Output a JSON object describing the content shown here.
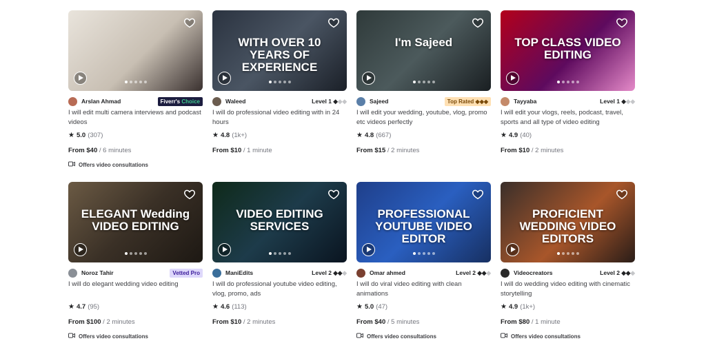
{
  "icons": {
    "favorite": "heart-icon",
    "play": "play-icon",
    "rating": "star-icon",
    "video": "video-camera-icon"
  },
  "gigs": [
    {
      "seller": "Arslan Ahmad",
      "badge": {
        "type": "choice",
        "text": "Fiverr's",
        "accent": "Choice"
      },
      "title": "I will edit multi camera interviews and podcast videos",
      "rating": "5.0",
      "reviews": "(307)",
      "price": "From $40",
      "delivery": "/ 6 minutes",
      "consultation": "Offers video consultations",
      "thumb_bg": "linear-gradient(135deg,#e9e4dc 0%,#c8bfb3 55%,#3b3230 100%)",
      "thumb_text": "",
      "avatar_color": "#b86b55"
    },
    {
      "seller": "Waleed",
      "level": {
        "text": "Level 1",
        "on": 1,
        "total": 3
      },
      "title": "I will do professional video editing with in 24 hours",
      "rating": "4.8",
      "reviews": "(1k+)",
      "price": "From $10",
      "delivery": "/ 1 minute",
      "thumb_bg": "linear-gradient(135deg,#2b3340 0%,#4a5563 50%,#1b2028 100%)",
      "thumb_text": "WITH OVER 10 YEARS OF EXPERIENCE",
      "avatar_color": "#6b5c4f"
    },
    {
      "seller": "Sajeed",
      "badge": {
        "type": "toprated",
        "text": "Top Rated ◆◆◆"
      },
      "title": "I will edit your wedding, youtube, vlog, promo etc videos perfectly",
      "rating": "4.8",
      "reviews": "(667)",
      "price": "From $15",
      "delivery": "/ 2 minutes",
      "thumb_bg": "linear-gradient(135deg,#2f3a3a 0%,#4c5a5c 50%,#1a1f22 100%)",
      "thumb_text": "I'm Sajeed",
      "avatar_color": "#5a7fa8"
    },
    {
      "seller": "Tayyaba",
      "level": {
        "text": "Level 1",
        "on": 1,
        "total": 3
      },
      "title": "I will edit your vlogs, reels, podcast, travel, sports and all type of video editing",
      "rating": "4.9",
      "reviews": "(40)",
      "price": "From $10",
      "delivery": "/ 2 minutes",
      "thumb_bg": "linear-gradient(135deg,#b3001b 0%,#5e0a5e 55%,#e48ac8 100%)",
      "thumb_text": "TOP CLASS VIDEO EDITING",
      "avatar_color": "#c48a6a"
    },
    {
      "seller": "Noroz Tahir",
      "badge": {
        "type": "vetted",
        "text": "Vetted Pro"
      },
      "title": "I will do elegant wedding video editing",
      "rating": "4.7",
      "reviews": "(95)",
      "price": "From $100",
      "delivery": "/ 2 minutes",
      "consultation": "Offers video consultations",
      "thumb_bg": "linear-gradient(135deg,#6b5a44 0%,#3a3026 50%,#1d1813 100%)",
      "thumb_text": "ELEGANT Wedding VIDEO EDITING",
      "avatar_color": "#8a8f96"
    },
    {
      "seller": "ManiEdits",
      "level": {
        "text": "Level 2",
        "on": 2,
        "total": 3
      },
      "title": "I will do professional youtube video editing, vlog, promo, ads",
      "rating": "4.6",
      "reviews": "(113)",
      "price": "From $10",
      "delivery": "/ 2 minutes",
      "thumb_bg": "linear-gradient(135deg,#0f2a1a 0%,#1d3b4a 50%,#0a1420 100%)",
      "thumb_text": "VIDEO EDITING SERVICES",
      "avatar_color": "#3a6e9a"
    },
    {
      "seller": "Omar ahmed",
      "level": {
        "text": "Level 2",
        "on": 2,
        "total": 3
      },
      "title": "I will do viral video editing with clean animations",
      "rating": "5.0",
      "reviews": "(47)",
      "price": "From $40",
      "delivery": "/ 5 minutes",
      "consultation": "Offers video consultations",
      "thumb_bg": "linear-gradient(135deg,#1f3f8a 0%,#2a5fc0 50%,#173062 100%)",
      "thumb_text": "PROFESSIONAL YOUTUBE VIDEO EDITOR",
      "avatar_color": "#7a4030"
    },
    {
      "seller": "Videocreators",
      "level": {
        "text": "Level 2",
        "on": 2,
        "total": 3
      },
      "title": "I will do wedding video editing with cinematic storytelling",
      "rating": "4.9",
      "reviews": "(1k+)",
      "price": "From $80",
      "delivery": "/ 1 minute",
      "consultation": "Offers video consultations",
      "thumb_bg": "linear-gradient(135deg,#3a2f2a 0%,#a8562a 55%,#2a1d18 100%)",
      "thumb_text": "PROFICIENT WEDDING VIDEO EDITORS",
      "avatar_color": "#2a2a2a"
    }
  ]
}
